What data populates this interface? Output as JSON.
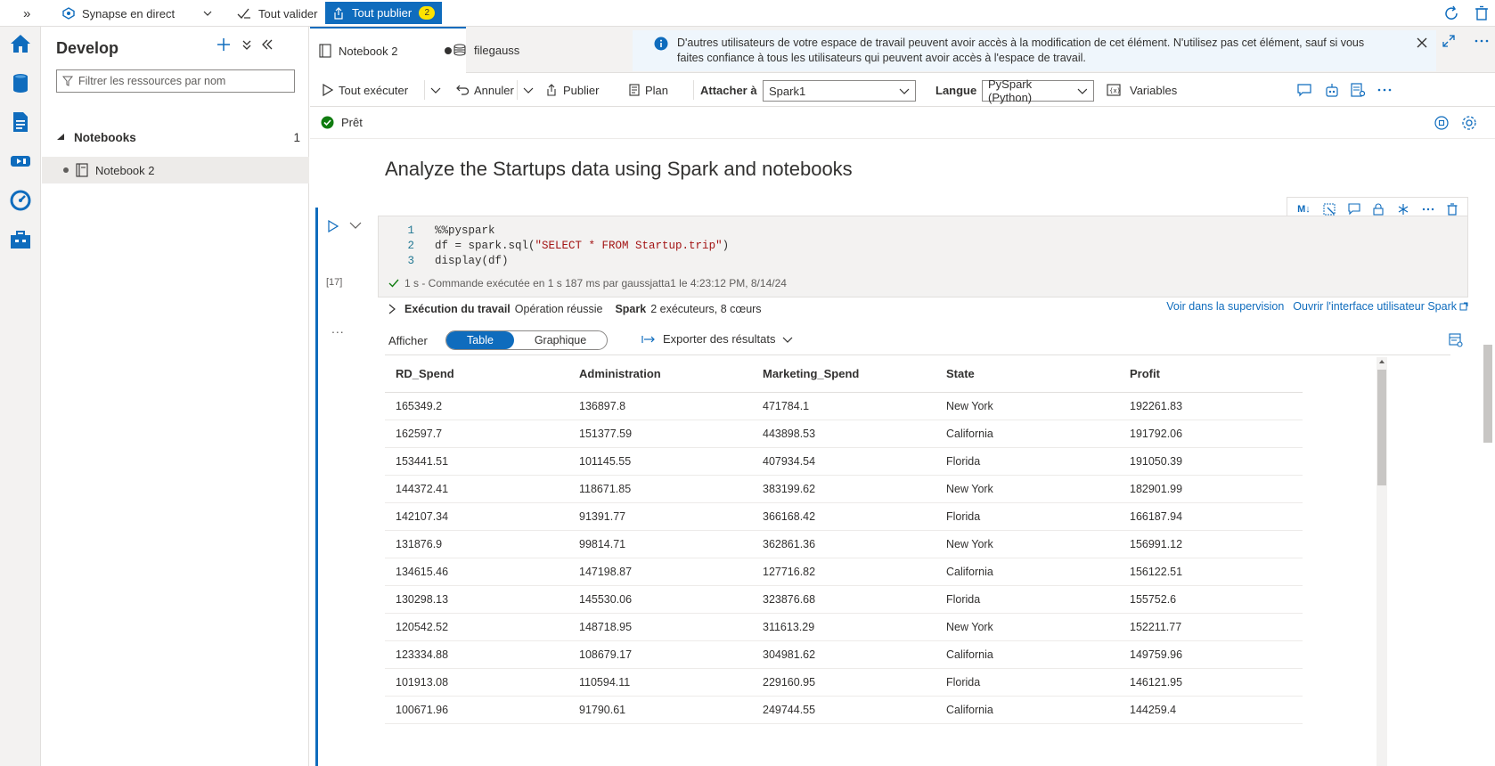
{
  "topbar": {
    "expand_glyph": "»",
    "mode_label": "Synapse en direct",
    "validate_label": "Tout valider",
    "publish_label": "Tout publier",
    "publish_count": "2"
  },
  "develop": {
    "title": "Develop",
    "filter_placeholder": "Filtrer les ressources par nom",
    "group_label": "Notebooks",
    "group_count": "1",
    "item_label": "Notebook 2"
  },
  "tabs": [
    {
      "label": "Notebook 2"
    },
    {
      "label": "filegauss"
    }
  ],
  "banner": {
    "text": "D'autres utilisateurs de votre espace de travail peuvent avoir accès à la modification de cet élément. N'utilisez pas cet élément, sauf si vous faites confiance à tous les utilisateurs qui peuvent avoir accès à l'espace de travail."
  },
  "toolbar": {
    "run_all": "Tout exécuter",
    "cancel": "Annuler",
    "publish": "Publier",
    "plan": "Plan",
    "attach_label": "Attacher à",
    "attach_value": "Spark1",
    "lang_label": "Langue",
    "lang_value": "PySpark (Python)",
    "variables": "Variables"
  },
  "status": {
    "text": "Prêt"
  },
  "notebook": {
    "title": "Analyze the Startups data using Spark and notebooks",
    "code_lines": [
      {
        "n": "1",
        "code": "%%pyspark"
      },
      {
        "n": "2",
        "code_pre": "df = spark.sql(",
        "code_str": "\"SELECT * FROM Startup.trip\"",
        "code_post": ")"
      },
      {
        "n": "3",
        "code": "display(df)"
      }
    ],
    "exec_count": "[17]",
    "exec_summary": "1 s - Commande exécutée en 1 s 187 ms par gaussjatta1 le 4:23:12 PM, 8/14/24",
    "job_label": "Exécution du travail",
    "job_status": "Opération réussie",
    "spark_label": "Spark",
    "spark_info": "2 exécuteurs, 8 cœurs",
    "link_monitor": "Voir dans la supervision",
    "link_spark_ui": "Ouvrir l'interface utilisateur Spark",
    "more_glyph": "...",
    "view_label": "Afficher",
    "view_table": "Table",
    "view_chart": "Graphique",
    "export_label": "Exporter des résultats"
  },
  "table": {
    "columns": [
      "RD_Spend",
      "Administration",
      "Marketing_Spend",
      "State",
      "Profit"
    ],
    "rows": [
      [
        "165349.2",
        "136897.8",
        "471784.1",
        "New York",
        "192261.83"
      ],
      [
        "162597.7",
        "151377.59",
        "443898.53",
        "California",
        "191792.06"
      ],
      [
        "153441.51",
        "101145.55",
        "407934.54",
        "Florida",
        "191050.39"
      ],
      [
        "144372.41",
        "118671.85",
        "383199.62",
        "New York",
        "182901.99"
      ],
      [
        "142107.34",
        "91391.77",
        "366168.42",
        "Florida",
        "166187.94"
      ],
      [
        "131876.9",
        "99814.71",
        "362861.36",
        "New York",
        "156991.12"
      ],
      [
        "134615.46",
        "147198.87",
        "127716.82",
        "California",
        "156122.51"
      ],
      [
        "130298.13",
        "145530.06",
        "323876.68",
        "Florida",
        "155752.6"
      ],
      [
        "120542.52",
        "148718.95",
        "311613.29",
        "New York",
        "152211.77"
      ],
      [
        "123334.88",
        "108679.17",
        "304981.62",
        "California",
        "149759.96"
      ],
      [
        "101913.08",
        "110594.11",
        "229160.95",
        "Florida",
        "146121.95"
      ],
      [
        "100671.96",
        "91790.61",
        "249744.55",
        "California",
        "144259.4"
      ]
    ]
  },
  "colors": {
    "accent": "#0f6cbd",
    "status_ok": "#107c10",
    "badge": "#fde300"
  }
}
